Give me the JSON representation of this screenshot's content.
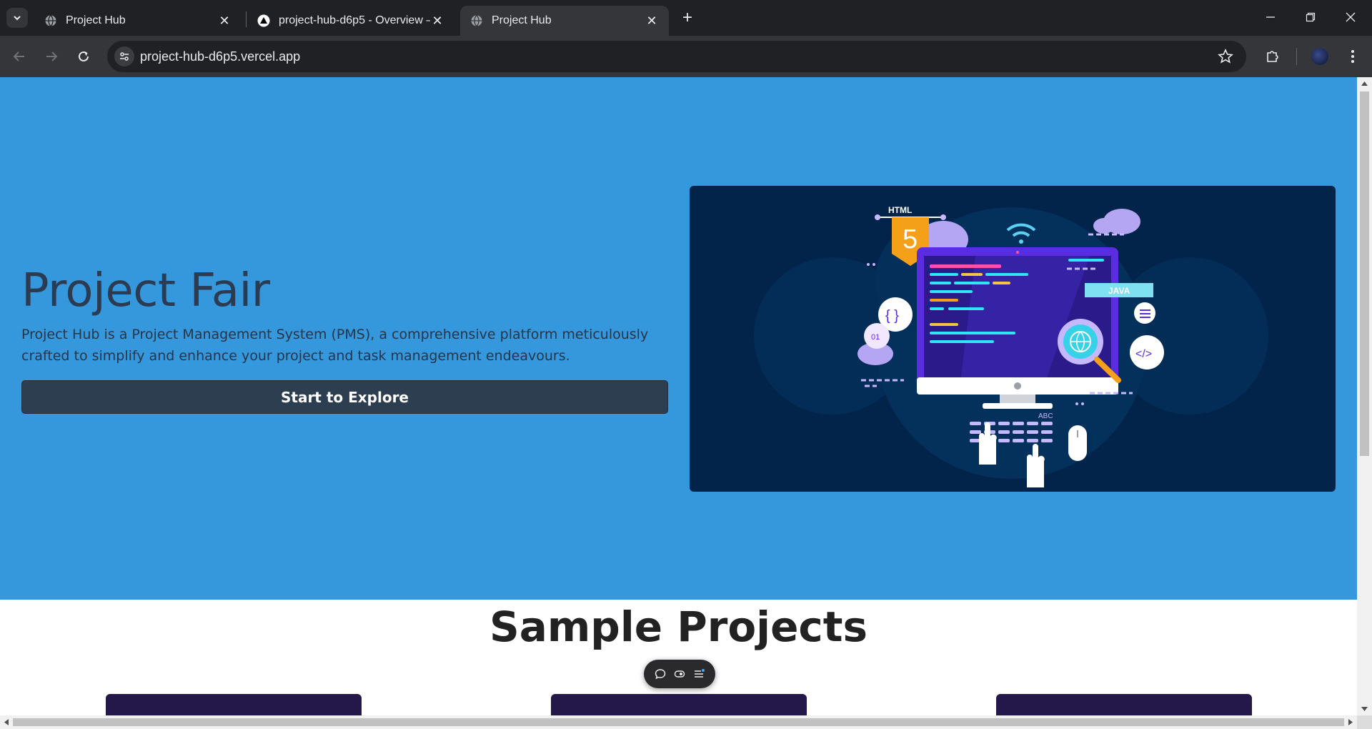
{
  "browser": {
    "tabs": [
      {
        "title": "Project Hub",
        "favicon": "globe-icon",
        "active": false
      },
      {
        "title": "project-hub-d6p5 - Overview –",
        "favicon": "vercel-icon",
        "active": false
      },
      {
        "title": "Project Hub",
        "favicon": "globe-icon",
        "active": true
      }
    ],
    "url": "project-hub-d6p5.vercel.app"
  },
  "hero": {
    "title": "Project Fair",
    "description": "Project Hub is a Project Management System (PMS), a comprehensive platform meticulously crafted to simplify and enhance your project and task management endeavours.",
    "button_label": "Start to Explore",
    "illustration": {
      "html_badge_label": "HTML",
      "html_badge_number": "5",
      "java_label": "JAVA",
      "abc_label": "ABC",
      "braces_label": "{ }",
      "binary_label": "01",
      "code_tag_label": "</>"
    }
  },
  "section": {
    "title": "Sample Projects"
  },
  "colors": {
    "hero_bg": "#3597dc",
    "button_bg": "#2d3e51",
    "illustration_bg": "#02244a"
  }
}
